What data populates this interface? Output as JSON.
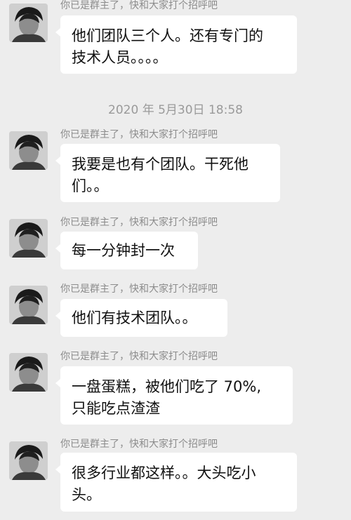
{
  "hint_text": "你已是群主了，快和大家打个招呼吧",
  "timestamp": "2020 年 5月30日 18:58",
  "messages": [
    {
      "lines": [
        "他们团队三个人。还有专门的",
        "技术人员。。。。"
      ]
    },
    {
      "lines": [
        "我要是也有个团队。干死他",
        "们。。"
      ]
    },
    {
      "lines": [
        "每一分钟封一次"
      ]
    },
    {
      "lines": [
        "他们有技术团队。。"
      ]
    },
    {
      "lines": [
        "一盘蛋糕，被他们吃了 70%,",
        "只能吃点渣渣"
      ]
    },
    {
      "lines": [
        "很多行业都这样。。大头吃小",
        "头。"
      ]
    }
  ]
}
